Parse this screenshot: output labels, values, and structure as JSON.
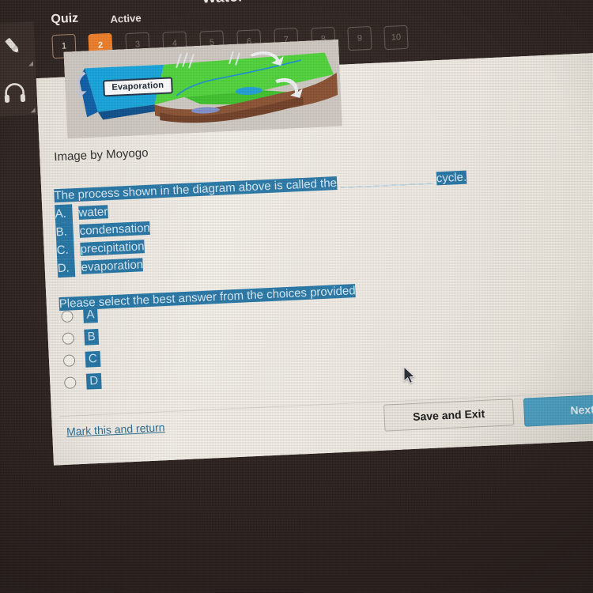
{
  "app": {
    "title": "Water",
    "quiz_label": "Quiz",
    "status_label": "Active"
  },
  "toolbar": {
    "items": [
      {
        "name": "highlighter-icon",
        "label": "Highlighter"
      },
      {
        "name": "headphones-icon",
        "label": "Read aloud"
      }
    ]
  },
  "question_nav": {
    "items": [
      {
        "number": "1",
        "state": "visited"
      },
      {
        "number": "2",
        "state": "current"
      },
      {
        "number": "3",
        "state": "locked"
      },
      {
        "number": "4",
        "state": "locked"
      },
      {
        "number": "5",
        "state": "locked"
      },
      {
        "number": "6",
        "state": "locked"
      },
      {
        "number": "7",
        "state": "locked"
      },
      {
        "number": "8",
        "state": "locked"
      },
      {
        "number": "9",
        "state": "locked"
      },
      {
        "number": "10",
        "state": "locked"
      }
    ]
  },
  "diagram": {
    "label": "Evaporation",
    "credit": "Image by Moyogo"
  },
  "question": {
    "stem_before_blank": "The process shown in the diagram above is called the",
    "stem_after_blank": "cycle.",
    "choices": [
      {
        "letter": "A.",
        "text": "water"
      },
      {
        "letter": "B.",
        "text": "condensation"
      },
      {
        "letter": "C.",
        "text": "precipitation"
      },
      {
        "letter": "D.",
        "text": "evaporation"
      }
    ],
    "instruction": "Please select the best answer from the choices provided"
  },
  "answers": {
    "options": [
      {
        "label": "A",
        "selected": false
      },
      {
        "label": "B",
        "selected": false
      },
      {
        "label": "C",
        "selected": false
      },
      {
        "label": "D",
        "selected": false
      }
    ]
  },
  "footer": {
    "mark_link": "Mark this and return",
    "save_exit_label": "Save and Exit",
    "next_label": "Next"
  },
  "colors": {
    "accent_orange": "#ef7f2a",
    "selection_blue": "#2476a6",
    "next_button_blue": "#4ea3c6",
    "link_blue": "#2e6f94",
    "chrome_dark": "#2f2522",
    "card_paper": "#efeae2"
  }
}
